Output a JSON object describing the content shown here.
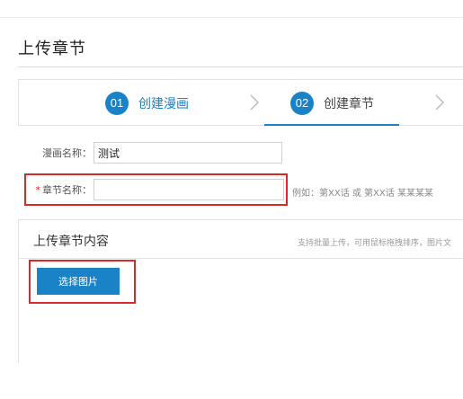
{
  "page": {
    "title": "上传章节"
  },
  "stepper": {
    "steps": [
      {
        "number": "01",
        "label": "创建漫画",
        "state": "completed"
      },
      {
        "number": "02",
        "label": "创建章节",
        "state": "active"
      }
    ],
    "icons": [
      "chevron-right-icon",
      "chevron-right-icon"
    ]
  },
  "form": {
    "comic_name_label": "漫画名称：",
    "comic_name_value": "测试",
    "chapter_name_required_mark": "*",
    "chapter_name_label": "章节名称：",
    "chapter_name_value": "",
    "chapter_name_hint": "例如：第XX话 或 第XX话 某某某某"
  },
  "upload": {
    "title": "上传章节内容",
    "hint": "支持批量上传，可用鼠标拖拽排序，图片文",
    "select_button_label": "选择图片"
  },
  "colors": {
    "accent": "#1a83c8",
    "highlight_border": "#d42a2a",
    "required": "#e02020"
  }
}
